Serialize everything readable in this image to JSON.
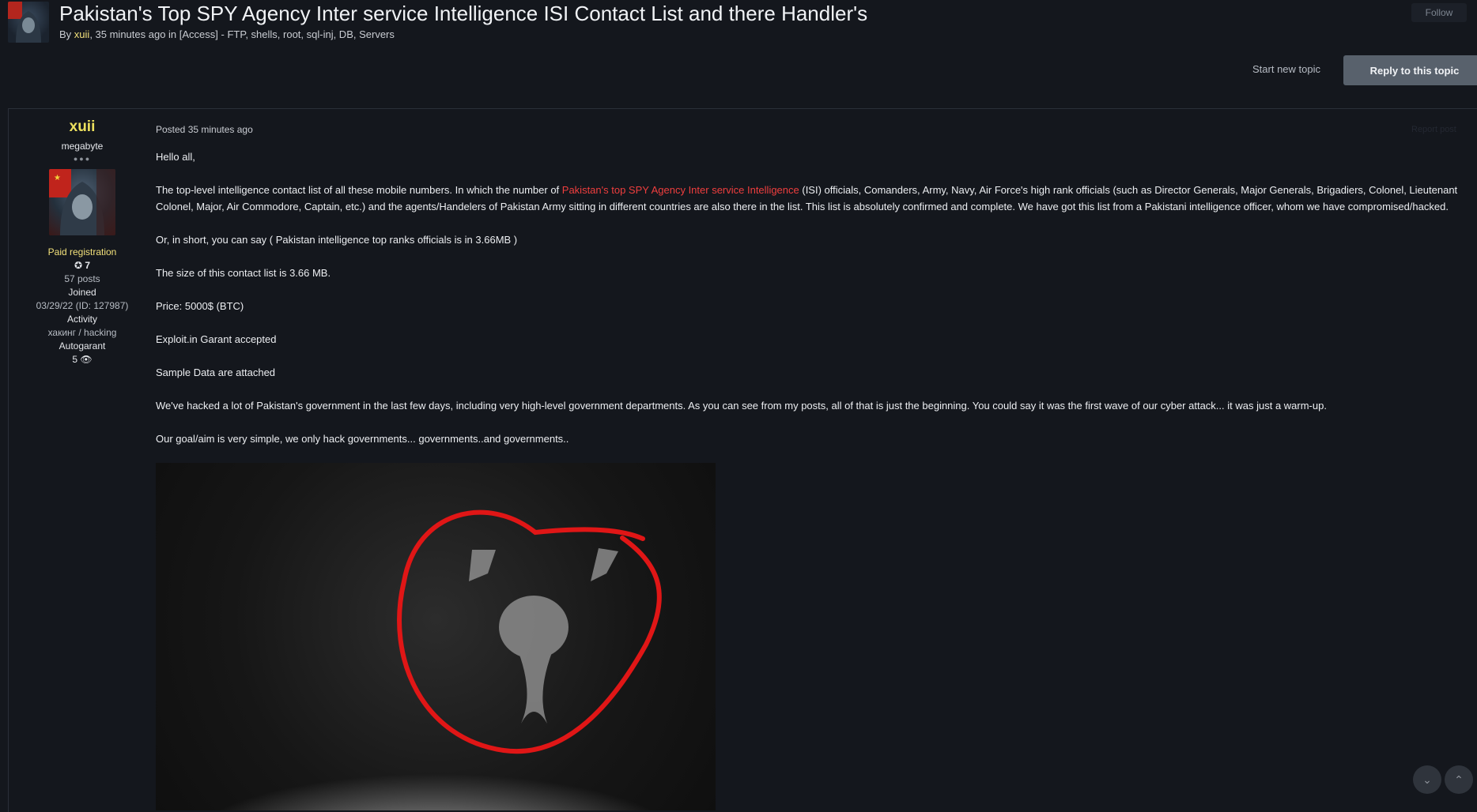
{
  "topic": {
    "title": "Pakistan's Top SPY Agency Inter service Intelligence ISI Contact List and there Handler's",
    "meta_prefix": "By ",
    "author": "xuii",
    "meta_suffix": ", 35 minutes ago in [Access] - FTP, shells, root, sql-inj, DB, Servers",
    "follow_label": "Follow",
    "start_new_topic_label": "Start new topic",
    "reply_label": "Reply to this topic"
  },
  "author_panel": {
    "name": "xuii",
    "rank": "megabyte",
    "group": "Paid registration",
    "reputation": "7",
    "posts": "57 posts",
    "joined_label": "Joined",
    "joined_value": "03/29/22 (ID: 127987)",
    "activity_label": "Activity",
    "activity_value": "хакинг / hacking",
    "autogarant_label": "Autogarant",
    "autogarant_value": "5"
  },
  "post": {
    "posted": "Posted 35 minutes ago",
    "report_label": "Report post",
    "greeting": "Hello all,",
    "p1_before": "The top-level intelligence contact list of all these mobile numbers. In which the number of ",
    "p1_link": "Pakistan's top SPY Agency Inter service Intelligence",
    "p1_after": "  (ISI) officials, Comanders, Army, Navy, Air Force's high rank officials (such as Director Generals, Major Generals, Brigadiers, Colonel, Lieutenant Colonel, Major, Air Commodore, Captain, etc.) and the agents/Handelers of Pakistan Army sitting in different countries are also there in the list. This list is absolutely confirmed and complete. We have got this list from a Pakistani intelligence officer, whom we have compromised/hacked.",
    "p2": "Or, in short, you can say ( Pakistan intelligence top ranks officials is in 3.66MB )",
    "p3": "The size of this contact list is 3.66 MB.",
    "p4": "Price: 5000$ (BTC)",
    "p5": "Exploit.in Garant accepted",
    "p6": "Sample Data are attached",
    "p7": "We've hacked a lot of Pakistan's government in the last few days, including very high-level government departments. As you can see from my posts, all of that is just the beginning. You could say it was the first wave of our cyber attack... it was just a warm-up.",
    "p8": "Our goal/aim is very simple, we only hack governments... governments..and governments.."
  },
  "icons": {
    "reputation": "plus-circle-icon",
    "autogarant": "eye-icon",
    "scroll_down": "chevron-down-icon",
    "scroll_up": "chevron-up-icon"
  },
  "colors": {
    "background": "#14171d",
    "author_highlight": "#ece05e",
    "link": "#ef3e3e",
    "reply_button": "#58616c"
  }
}
